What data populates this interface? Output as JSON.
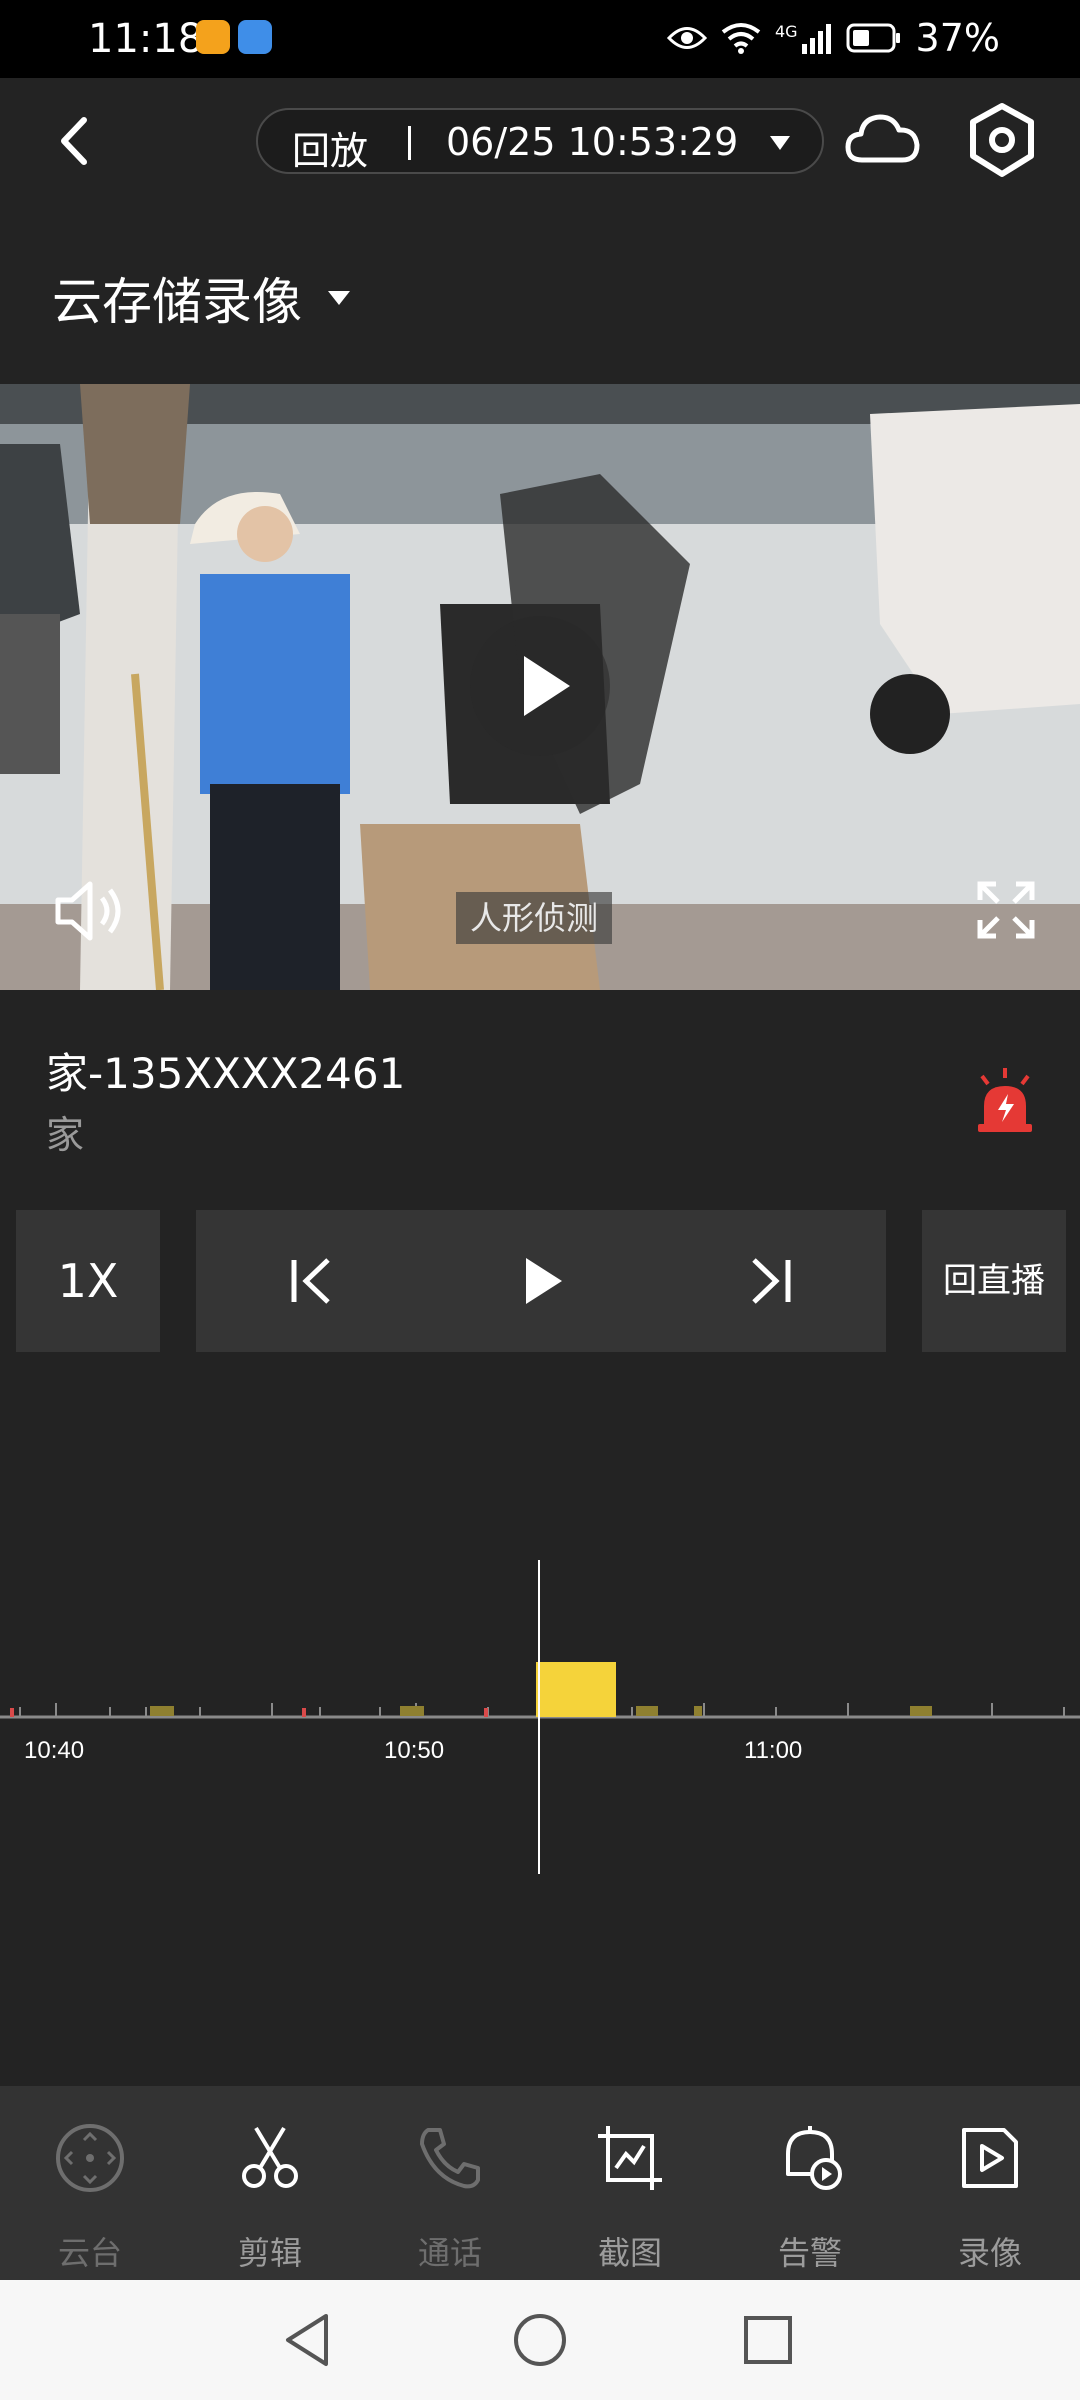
{
  "status_bar": {
    "time": "11:18",
    "battery_percent": "37%",
    "network": "4G"
  },
  "header": {
    "mode_label": "回放",
    "timestamp": "06/25 10:53:29"
  },
  "section": {
    "title": "云存储录像"
  },
  "video": {
    "detection_label": "人形侦测"
  },
  "device": {
    "name": "家-135XXXX2461",
    "group": "家"
  },
  "controls": {
    "speed": "1X",
    "live": "回直播"
  },
  "timeline": {
    "tick_labels": [
      "10:40",
      "10:50",
      "11:00"
    ],
    "current_time": "10:53:29",
    "event_color": "#f5d33a",
    "marker_color": "#d94a4a"
  },
  "toolbar": {
    "items": [
      {
        "label": "云台",
        "icon": "ptz-icon",
        "enabled": false
      },
      {
        "label": "剪辑",
        "icon": "scissors-icon",
        "enabled": true
      },
      {
        "label": "通话",
        "icon": "phone-icon",
        "enabled": false
      },
      {
        "label": "截图",
        "icon": "screenshot-icon",
        "enabled": true
      },
      {
        "label": "告警",
        "icon": "alarm-bell-icon",
        "enabled": true
      },
      {
        "label": "录像",
        "icon": "record-icon",
        "enabled": true
      }
    ]
  },
  "colors": {
    "background": "#232323",
    "panel": "#353535",
    "alarm_red": "#e53935"
  }
}
